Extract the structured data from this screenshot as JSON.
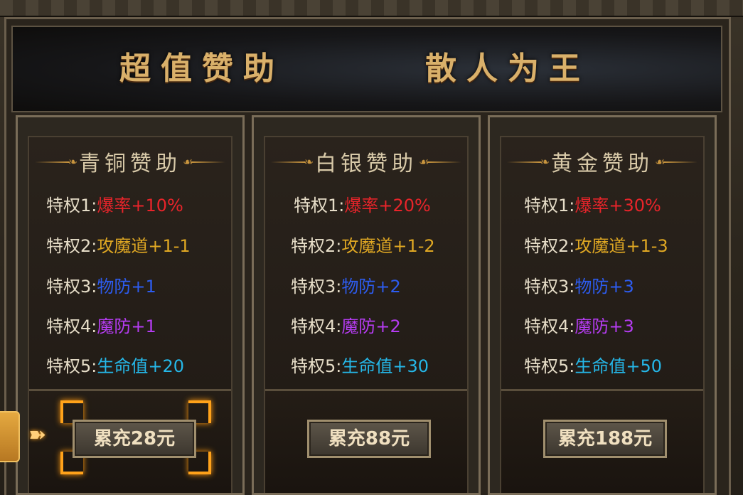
{
  "banner": {
    "left_title": "超值赞助",
    "right_title": "散人为王"
  },
  "cards": [
    {
      "title": "青铜赞助",
      "privileges": [
        {
          "label": "特权1:",
          "value": "爆率+10%"
        },
        {
          "label": "特权2:",
          "value": "攻魔道+1-1"
        },
        {
          "label": "特权3:",
          "value": "物防+1"
        },
        {
          "label": "特权4:",
          "value": "魔防+1"
        },
        {
          "label": "特权5:",
          "value": "生命值+20"
        }
      ],
      "button": "累充28元"
    },
    {
      "title": "白银赞助",
      "privileges": [
        {
          "label": "特权1:",
          "value": "爆率+20%"
        },
        {
          "label": "特权2:",
          "value": "攻魔道+1-2"
        },
        {
          "label": "特权3:",
          "value": "物防+2"
        },
        {
          "label": "特权4:",
          "value": "魔防+2"
        },
        {
          "label": "特权5:",
          "value": "生命值+30"
        }
      ],
      "button": "累充88元"
    },
    {
      "title": "黄金赞助",
      "privileges": [
        {
          "label": "特权1:",
          "value": "爆率+30%"
        },
        {
          "label": "特权2:",
          "value": "攻魔道+1-3"
        },
        {
          "label": "特权3:",
          "value": "物防+3"
        },
        {
          "label": "特权4:",
          "value": "魔防+3"
        },
        {
          "label": "特权5:",
          "value": "生命值+50"
        }
      ],
      "button": "累充188元"
    }
  ],
  "colors": {
    "drop_rate": "#e8242a",
    "attack": "#e0a823",
    "phys_def": "#2d5cf0",
    "magic_def": "#b53cf2",
    "hp": "#25b7e8",
    "highlight": "#ffa21a"
  },
  "icons": {
    "pointer": "arrow-right-icon",
    "ornament": "scroll-ornament-icon"
  }
}
